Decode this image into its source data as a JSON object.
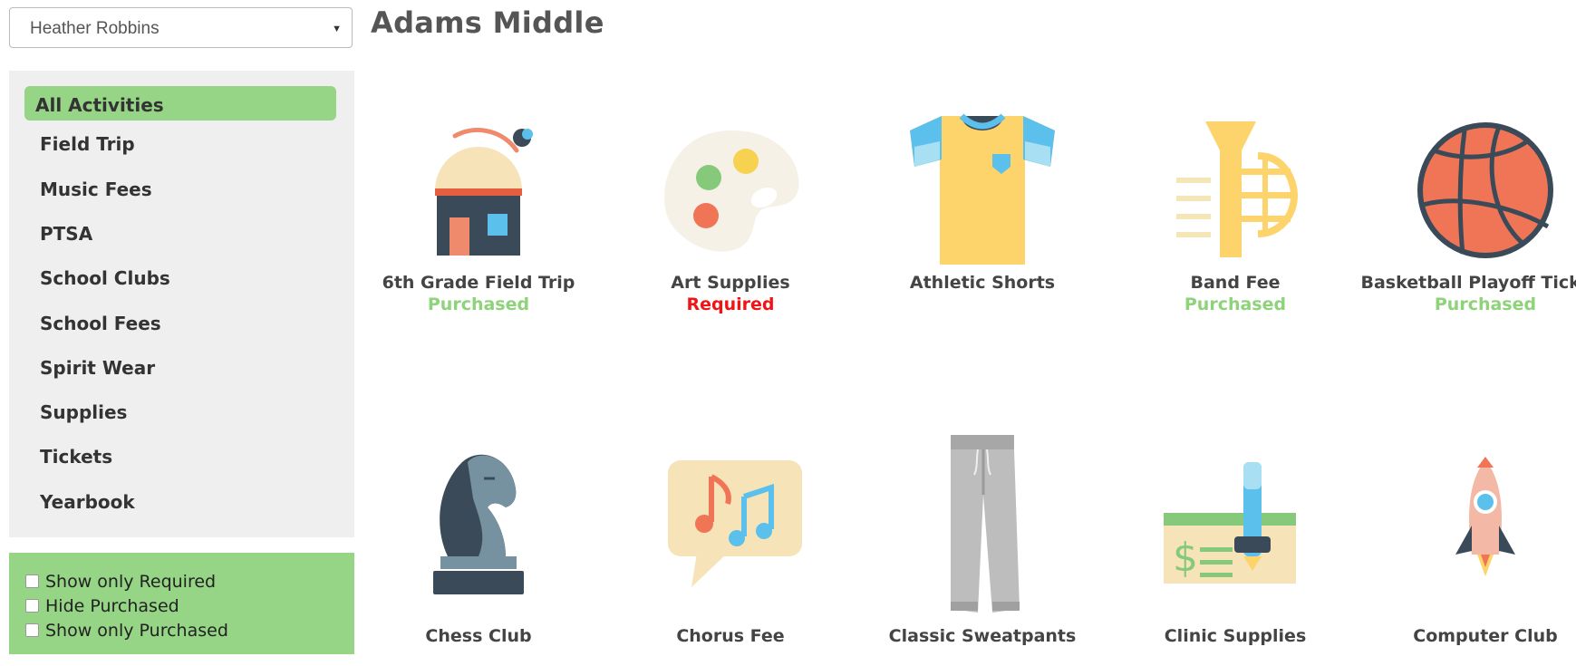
{
  "student_selector": {
    "selected": "Heather Robbins"
  },
  "school": {
    "name": "Adams Middle"
  },
  "categories": [
    {
      "label": "All Activities",
      "active": true
    },
    {
      "label": "Field Trip"
    },
    {
      "label": "Music Fees"
    },
    {
      "label": "PTSA"
    },
    {
      "label": "School Clubs"
    },
    {
      "label": "School Fees"
    },
    {
      "label": "Spirit Wear"
    },
    {
      "label": "Supplies"
    },
    {
      "label": "Tickets"
    },
    {
      "label": "Yearbook"
    }
  ],
  "filters": [
    {
      "label": "Show only Required",
      "checked": false
    },
    {
      "label": "Hide Purchased",
      "checked": false
    },
    {
      "label": "Show only Purchased",
      "checked": false
    }
  ],
  "activities": [
    {
      "name": "6th Grade Field Trip",
      "status": "Purchased",
      "icon": "observatory-icon"
    },
    {
      "name": "Art Supplies",
      "status": "Required",
      "icon": "palette-icon"
    },
    {
      "name": "Athletic Shorts",
      "status": "",
      "icon": "tshirt-icon"
    },
    {
      "name": "Band Fee",
      "status": "Purchased",
      "icon": "trumpet-icon"
    },
    {
      "name": "Basketball Playoff Tickets",
      "status": "Purchased",
      "icon": "basketball-icon"
    },
    {
      "name": "Chess Club",
      "status": "",
      "icon": "chess-knight-icon"
    },
    {
      "name": "Chorus Fee",
      "status": "",
      "icon": "music-notes-icon"
    },
    {
      "name": "Classic Sweatpants",
      "status": "",
      "icon": "sweatpants-icon"
    },
    {
      "name": "Clinic Supplies",
      "status": "",
      "icon": "check-pen-icon"
    },
    {
      "name": "Computer Club",
      "status": "",
      "icon": "rocket-icon"
    }
  ],
  "colors": {
    "accent_green": "#95d585",
    "purchased": "#8ed37a",
    "required": "#f21414",
    "panel_bg": "#efefef"
  }
}
